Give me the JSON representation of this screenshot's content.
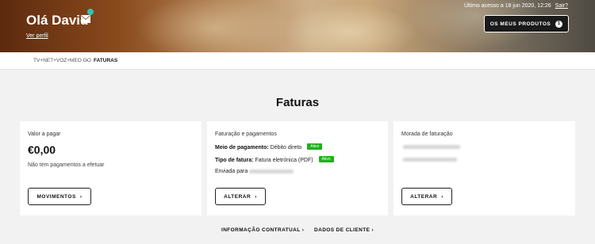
{
  "header": {
    "greeting": "Olá David",
    "profile_link": "Ver perfil",
    "last_access": "Último acesso a 18 jun 2020, 12:26",
    "logout": "Sair?",
    "products_button": "OS MEUS PRODUTOS",
    "products_count": "1"
  },
  "breadcrumb": {
    "parent": "TV+NET+VOZ+MEO GO",
    "separator": "›",
    "current": "FATURAS"
  },
  "page": {
    "title": "Faturas"
  },
  "cards": {
    "payment": {
      "label": "Valor a pagar",
      "amount": "€0,00",
      "status": "Não tem pagamentos a efetuar",
      "button": "MOVIMENTOS"
    },
    "billing": {
      "label": "Faturação e pagamentos",
      "payment_method_label": "Meio de pagamento:",
      "payment_method_value": "Débito direto",
      "payment_method_badge": "Ativo",
      "invoice_type_label": "Tipo de fatura:",
      "invoice_type_value": "Fatura eletrónica (PDF)",
      "invoice_type_badge": "Ativo",
      "sent_to": "Enviada para",
      "button": "ALTERAR"
    },
    "address": {
      "label": "Morada de faturação",
      "button": "ALTERAR"
    }
  },
  "footer_links": {
    "contract": "INFORMAÇÃO CONTRATUAL",
    "client": "DADOS DE CLIENTE"
  },
  "icons": {
    "chevron": "›"
  },
  "colors": {
    "badge": "#1db11d",
    "notification": "#36c3b6"
  }
}
